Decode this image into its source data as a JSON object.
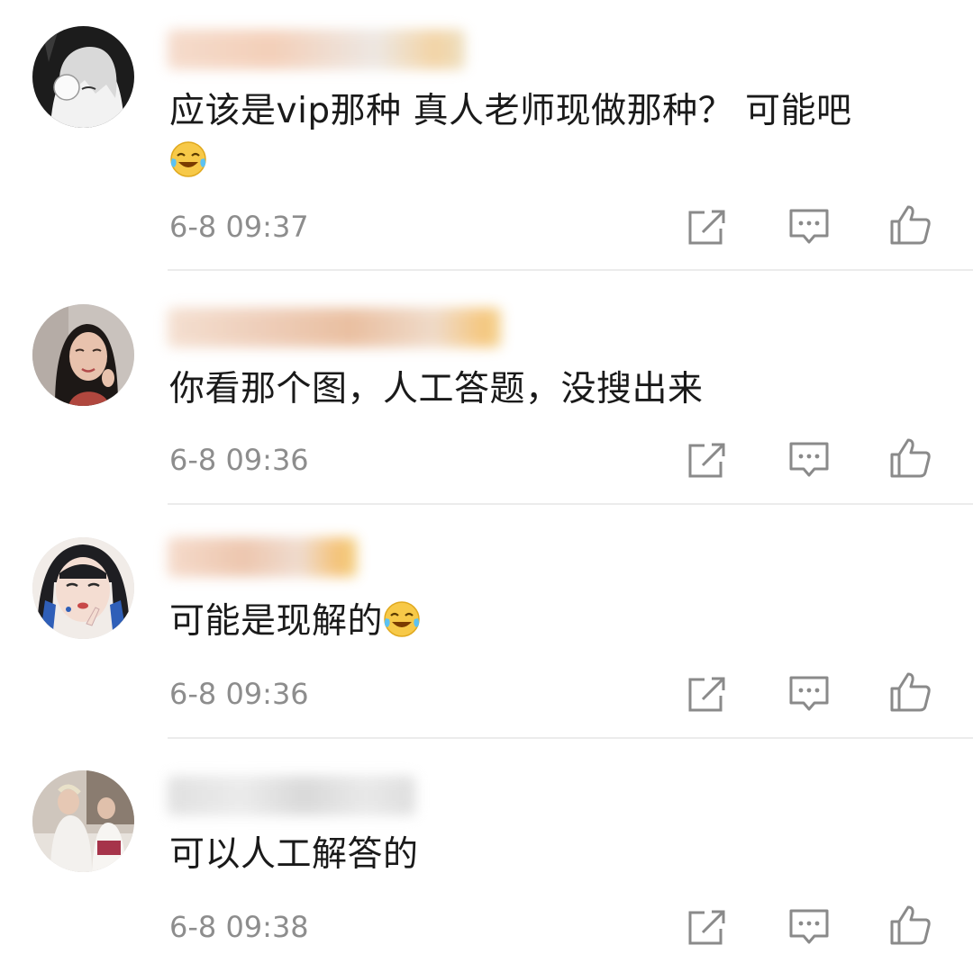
{
  "comments": [
    {
      "text": "应该是vip那种 真人老师现做那种？ 可能吧",
      "emoji": "laughing-crying-emoji",
      "time": "6-8 09:37",
      "avatar": "avatar-anime-girl"
    },
    {
      "text": "你看那个图，人工答题，没搜出来",
      "time": "6-8 09:36",
      "avatar": "avatar-woman-photo"
    },
    {
      "text": "可能是现解的",
      "emoji": "laughing-crying-emoji",
      "time": "6-8 09:36",
      "avatar": "avatar-illustrated-girl"
    },
    {
      "text": "可以人工解答的",
      "time": "6-8 09:38",
      "avatar": "avatar-group-photo"
    }
  ],
  "actions": {
    "repost_icon": "repost-icon",
    "reply_icon": "comment-icon",
    "like_icon": "thumbs-up-icon"
  },
  "colors": {
    "text": "#1a1a1a",
    "time": "#8d8d8d",
    "icon": "#8a8a8a",
    "divider": "#ececec",
    "blurred_name": "#f0c9b0"
  }
}
